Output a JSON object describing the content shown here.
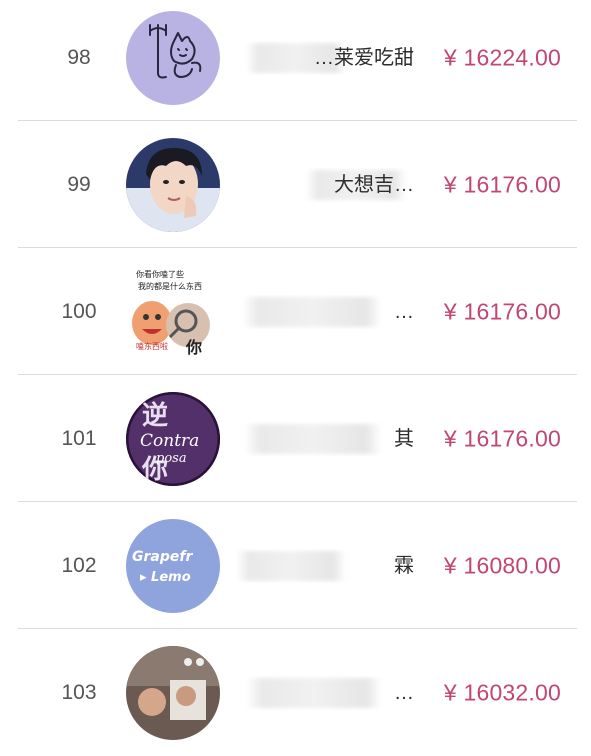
{
  "currency_symbol": "¥",
  "accent_color": "#c1476f",
  "rows": [
    {
      "rank": "98",
      "name": "…莱爱吃甜",
      "amount": "¥ 16224.00",
      "avatar": "trident-cat-sketch-icon"
    },
    {
      "rank": "99",
      "name": "大想吉…",
      "amount": "¥ 16176.00",
      "avatar": "portrait-photo-icon"
    },
    {
      "rank": "100",
      "name": "…",
      "amount": "¥ 16176.00",
      "avatar": "meme-sticker-icon",
      "avatar_text": [
        "你看你嗑了些",
        "我的都是什么东西",
        "你",
        "嗑东西啦"
      ]
    },
    {
      "rank": "101",
      "name": "其",
      "amount": "¥ 16176.00",
      "avatar": "calligraphy-badge-icon",
      "avatar_text": [
        "Contra",
        "posa"
      ]
    },
    {
      "rank": "102",
      "name": "霖",
      "amount": "¥ 16080.00",
      "avatar": "grapefruit-lemon-badge-icon",
      "avatar_text": [
        "Grapefr",
        "▸ Lemo"
      ]
    },
    {
      "rank": "103",
      "name": "…",
      "amount": "¥ 16032.00",
      "avatar": "group-photo-icon"
    }
  ]
}
